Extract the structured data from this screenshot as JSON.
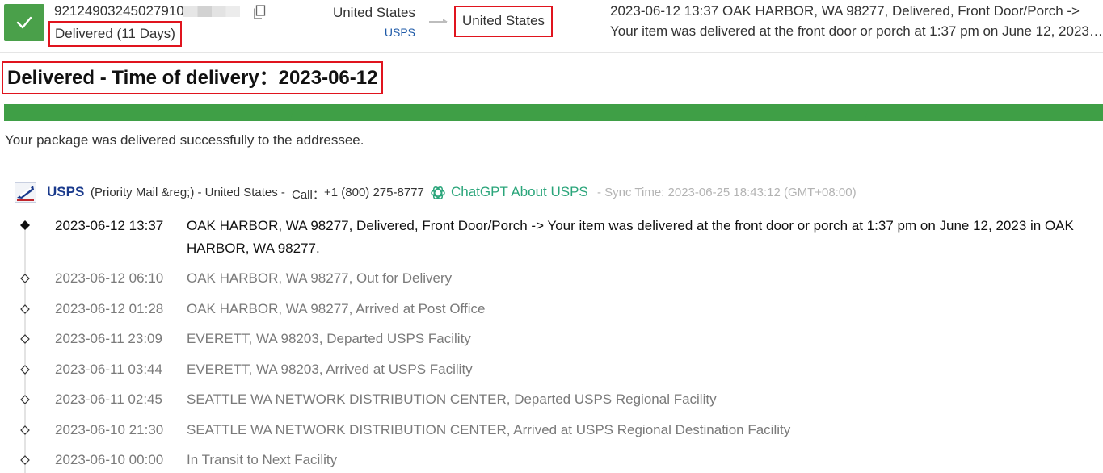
{
  "shipment": {
    "tracking_number": "9212490324502791​0",
    "status": "Delivered (11 Days)",
    "origin_country": "United States",
    "carrier_label": "USPS",
    "destination_country": "United States",
    "latest_event_line1": "2023-06-12 13:37  OAK HARBOR, WA 98277, Delivered, Front Door/Porch ->",
    "latest_event_line2": "Your item was delivered at the front door or porch at 1:37 pm on June 12, 2023 in OAK HARBOR, WA 98277."
  },
  "headline": "Delivered - Time of delivery：2023-06-12",
  "progress": {
    "segments": 4,
    "completed": 4,
    "color": "#3f9f46"
  },
  "summary": "Your package was delivered successfully to the addressee.",
  "carrier": {
    "name": "USPS",
    "service": "(Priority Mail &reg;) - United States  -",
    "call_label": "Call：",
    "phone": "+1 (800) 275-8777",
    "chatgpt_link": "ChatGPT About USPS",
    "sync_time": "- Sync Time: 2023-06-25 18:43:12 (GMT+08:00)"
  },
  "events": [
    {
      "time": "2023-06-12 13:37",
      "description": "OAK HARBOR, WA 98277, Delivered, Front Door/Porch -> Your item was delivered at the front door or porch at 1:37 pm on June 12, 2023 in OAK HARBOR, WA 98277."
    },
    {
      "time": "2023-06-12 06:10",
      "description": "OAK HARBOR, WA 98277, Out for Delivery"
    },
    {
      "time": "2023-06-12 01:28",
      "description": "OAK HARBOR, WA 98277, Arrived at Post Office"
    },
    {
      "time": "2023-06-11 23:09",
      "description": "EVERETT, WA 98203, Departed USPS Facility"
    },
    {
      "time": "2023-06-11 03:44",
      "description": "EVERETT, WA 98203, Arrived at USPS Facility"
    },
    {
      "time": "2023-06-11 02:45",
      "description": "SEATTLE WA NETWORK DISTRIBUTION CENTER, Departed USPS Regional Facility"
    },
    {
      "time": "2023-06-10 21:30",
      "description": "SEATTLE WA NETWORK DISTRIBUTION CENTER, Arrived at USPS Regional Destination Facility"
    },
    {
      "time": "2023-06-10 00:00",
      "description": "In Transit to Next Facility"
    }
  ],
  "icons": {
    "status": "checkmark-icon",
    "copy": "copy-icon",
    "route": "arrow-right-icon",
    "carrier_logo": "usps-eagle-logo",
    "chatgpt": "openai-icon",
    "latest_event_marker": "filled-diamond-icon",
    "event_marker": "hollow-diamond-icon"
  }
}
